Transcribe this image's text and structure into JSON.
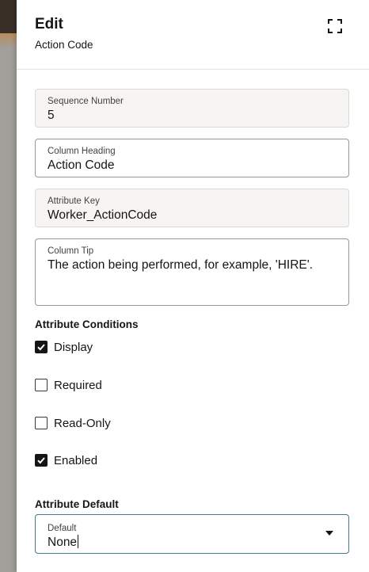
{
  "drawer": {
    "title": "Edit",
    "subtitle": "Action Code"
  },
  "fields": {
    "sequence_number": {
      "label": "Sequence Number",
      "value": "5"
    },
    "column_heading": {
      "label": "Column Heading",
      "value": "Action Code"
    },
    "attribute_key": {
      "label": "Attribute Key",
      "value": "Worker_ActionCode"
    },
    "column_tip": {
      "label": "Column Tip",
      "value": "The action being performed, for example, 'HIRE'."
    }
  },
  "attribute_conditions": {
    "heading": "Attribute Conditions",
    "display": {
      "label": "Display",
      "checked": true
    },
    "required": {
      "label": "Required",
      "checked": false
    },
    "read_only": {
      "label": "Read-Only",
      "checked": false
    },
    "enabled": {
      "label": "Enabled",
      "checked": true
    }
  },
  "attribute_default": {
    "heading": "Attribute Default",
    "default_select": {
      "label": "Default",
      "value": "None"
    }
  }
}
